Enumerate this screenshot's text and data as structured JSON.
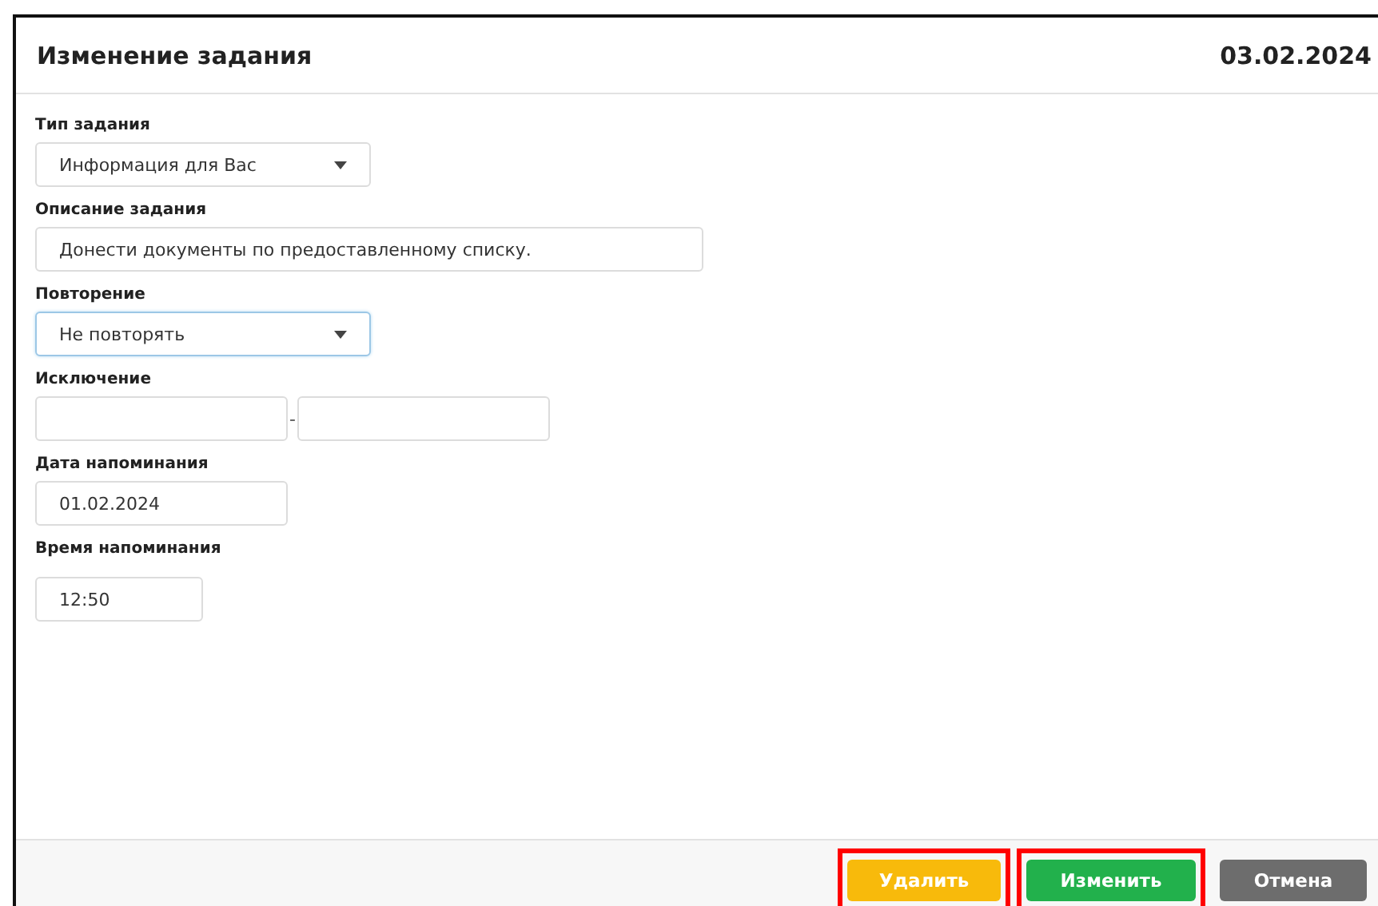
{
  "dialog": {
    "title": "Изменение задания",
    "date": "03.02.2024"
  },
  "fields": [
    {
      "kind": "select",
      "label": "Тип задания",
      "value": "Информация для Вас",
      "focused": false
    },
    {
      "kind": "text",
      "label": "Описание задания",
      "value": "Донести документы по предоставленному списку.",
      "focused": false
    },
    {
      "kind": "select",
      "label": "Повторение",
      "value": "Не повторять",
      "focused": true
    },
    {
      "kind": "range",
      "label": "Исключение",
      "separator": "-",
      "focused": false
    },
    {
      "kind": "text",
      "label": "Дата напоминания",
      "value": "01.02.2024",
      "focused": false
    },
    {
      "kind": "text",
      "label": "Время напоминания",
      "value": "12:50",
      "focused": false
    }
  ],
  "buttons": [
    {
      "label": "Удалить",
      "kind": "delete",
      "highlighted": true
    },
    {
      "label": "Изменить",
      "kind": "save",
      "highlighted": true
    },
    {
      "label": "Отмена",
      "kind": "cancel",
      "highlighted": false
    }
  ]
}
